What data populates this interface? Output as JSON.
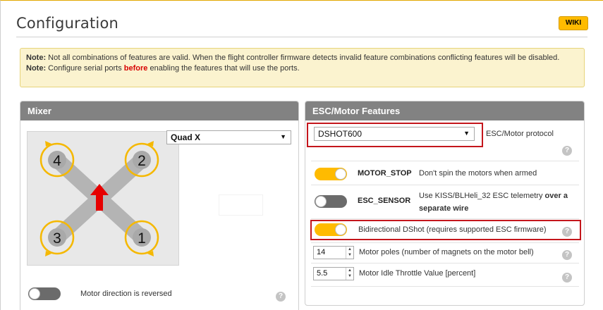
{
  "page": {
    "title": "Configuration",
    "wiki_label": "WIKI"
  },
  "note": {
    "line1_prefix": "Note:",
    "line1_text": " Not all combinations of features are valid. When the flight controller firmware detects invalid feature combinations conflicting features will be disabled.",
    "line2_prefix": "Note:",
    "line2_a": " Configure serial ports ",
    "line2_highlight": "before",
    "line2_b": " enabling the features that will use the ports."
  },
  "mixer": {
    "title": "Mixer",
    "selected": "Quad X",
    "motors": [
      "4",
      "2",
      "3",
      "1"
    ],
    "direction_label": "Motor direction is reversed",
    "direction_reversed": false
  },
  "esc": {
    "title": "ESC/Motor Features",
    "protocol_selected": "DSHOT600",
    "protocol_label": "ESC/Motor protocol",
    "motor_stop": {
      "name": "MOTOR_STOP",
      "desc": "Don't spin the motors when armed",
      "enabled": true
    },
    "esc_sensor": {
      "name": "ESC_SENSOR",
      "desc_a": "Use KISS/BLHeli_32 ESC telemetry ",
      "desc_bold": "over a separate wire",
      "enabled": false
    },
    "bidir": {
      "desc": "Bidirectional DShot (requires supported ESC firmware)",
      "enabled": true
    },
    "motor_poles": {
      "value": "14",
      "label": "Motor poles (number of magnets on the motor bell)"
    },
    "idle_throttle": {
      "value": "5.5",
      "label": "Motor Idle Throttle Value [percent]"
    }
  },
  "icons": {
    "help": "?",
    "dropdown": "▼",
    "spin_up": "▲",
    "spin_down": "▼"
  },
  "colors": {
    "accent": "#ffbb00",
    "panel_header": "#828282",
    "note_bg": "#fbf3cf",
    "highlight_red": "#c4161c",
    "motor_ring": "#f5b800"
  }
}
